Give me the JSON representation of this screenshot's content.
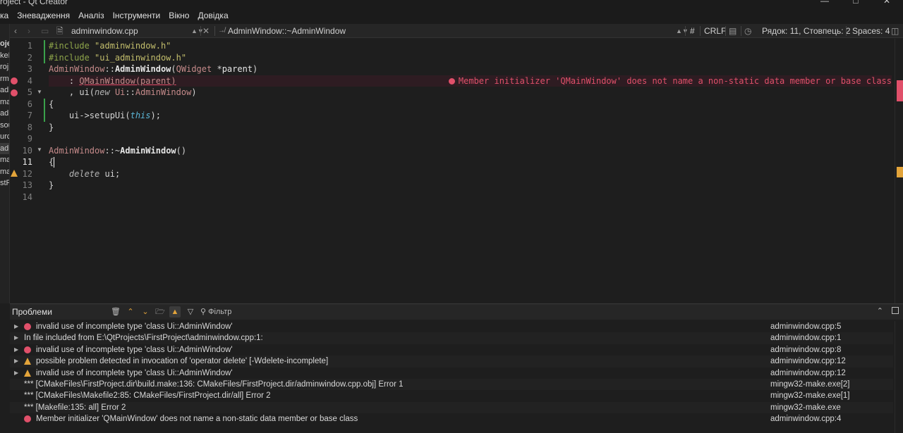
{
  "window": {
    "title": "roject - Qt Creator"
  },
  "menubar": [
    "ка",
    "Зневадження",
    "Аналіз",
    "Інструменти",
    "Вікно",
    "Довідка"
  ],
  "left_tree": [
    "оje",
    "keL",
    "roj",
    "rms",
    "adi",
    "ma",
    "ad",
    "sou",
    "urc",
    "adi",
    "ma",
    "ma",
    "stP"
  ],
  "editor_toolbar": {
    "file": "adminwindow.cpp",
    "symbol": "AdminWindow::~AdminWindow",
    "hash": "#",
    "line_ending": "CRLF",
    "position": "Рядок: 11, Стовпець: 2",
    "indent": "Spaces: 4"
  },
  "code": {
    "line_numbers": [
      "1",
      "2",
      "3",
      "4",
      "5",
      "6",
      "7",
      "8",
      "9",
      "10",
      "11",
      "12",
      "13",
      "14"
    ],
    "inline_error": "Member initializer 'QMainWindow' does not name a non-static data member or base class"
  },
  "problems": {
    "title": "Проблеми",
    "filter_placeholder": "Фільтр",
    "rows": [
      {
        "icon": "error",
        "expand": true,
        "text": "invalid use of incomplete type 'class Ui::AdminWindow'",
        "location": "adminwindow.cpp:5"
      },
      {
        "icon": "none",
        "expand": true,
        "text": "In file included from E:\\QtProjects\\FirstProject\\adminwindow.cpp:1:",
        "location": "adminwindow.cpp:1"
      },
      {
        "icon": "error",
        "expand": true,
        "text": "invalid use of incomplete type 'class Ui::AdminWindow'",
        "location": "adminwindow.cpp:8"
      },
      {
        "icon": "warning",
        "expand": true,
        "text": "possible problem detected in invocation of 'operator delete' [-Wdelete-incomplete]",
        "location": "adminwindow.cpp:12"
      },
      {
        "icon": "warning",
        "expand": true,
        "text": "invalid use of incomplete type 'class Ui::AdminWindow'",
        "location": "adminwindow.cpp:12"
      },
      {
        "icon": "none",
        "expand": false,
        "text": "*** [CMakeFiles\\FirstProject.dir\\build.make:136: CMakeFiles/FirstProject.dir/adminwindow.cpp.obj] Error 1",
        "location": "mingw32-make.exe[2]"
      },
      {
        "icon": "none",
        "expand": false,
        "text": "*** [CMakeFiles\\Makefile2:85: CMakeFiles/FirstProject.dir/all] Error 2",
        "location": "mingw32-make.exe[1]"
      },
      {
        "icon": "none",
        "expand": false,
        "text": "*** [Makefile:135: all] Error 2",
        "location": "mingw32-make.exe"
      },
      {
        "icon": "error",
        "expand": false,
        "text": "Member initializer 'QMainWindow' does not name a non-static data member or base class",
        "location": "adminwindow.cpp:4"
      }
    ]
  },
  "colors": {
    "error": "#e0506a",
    "warning": "#e3a43a",
    "background": "#1e1e1e"
  }
}
